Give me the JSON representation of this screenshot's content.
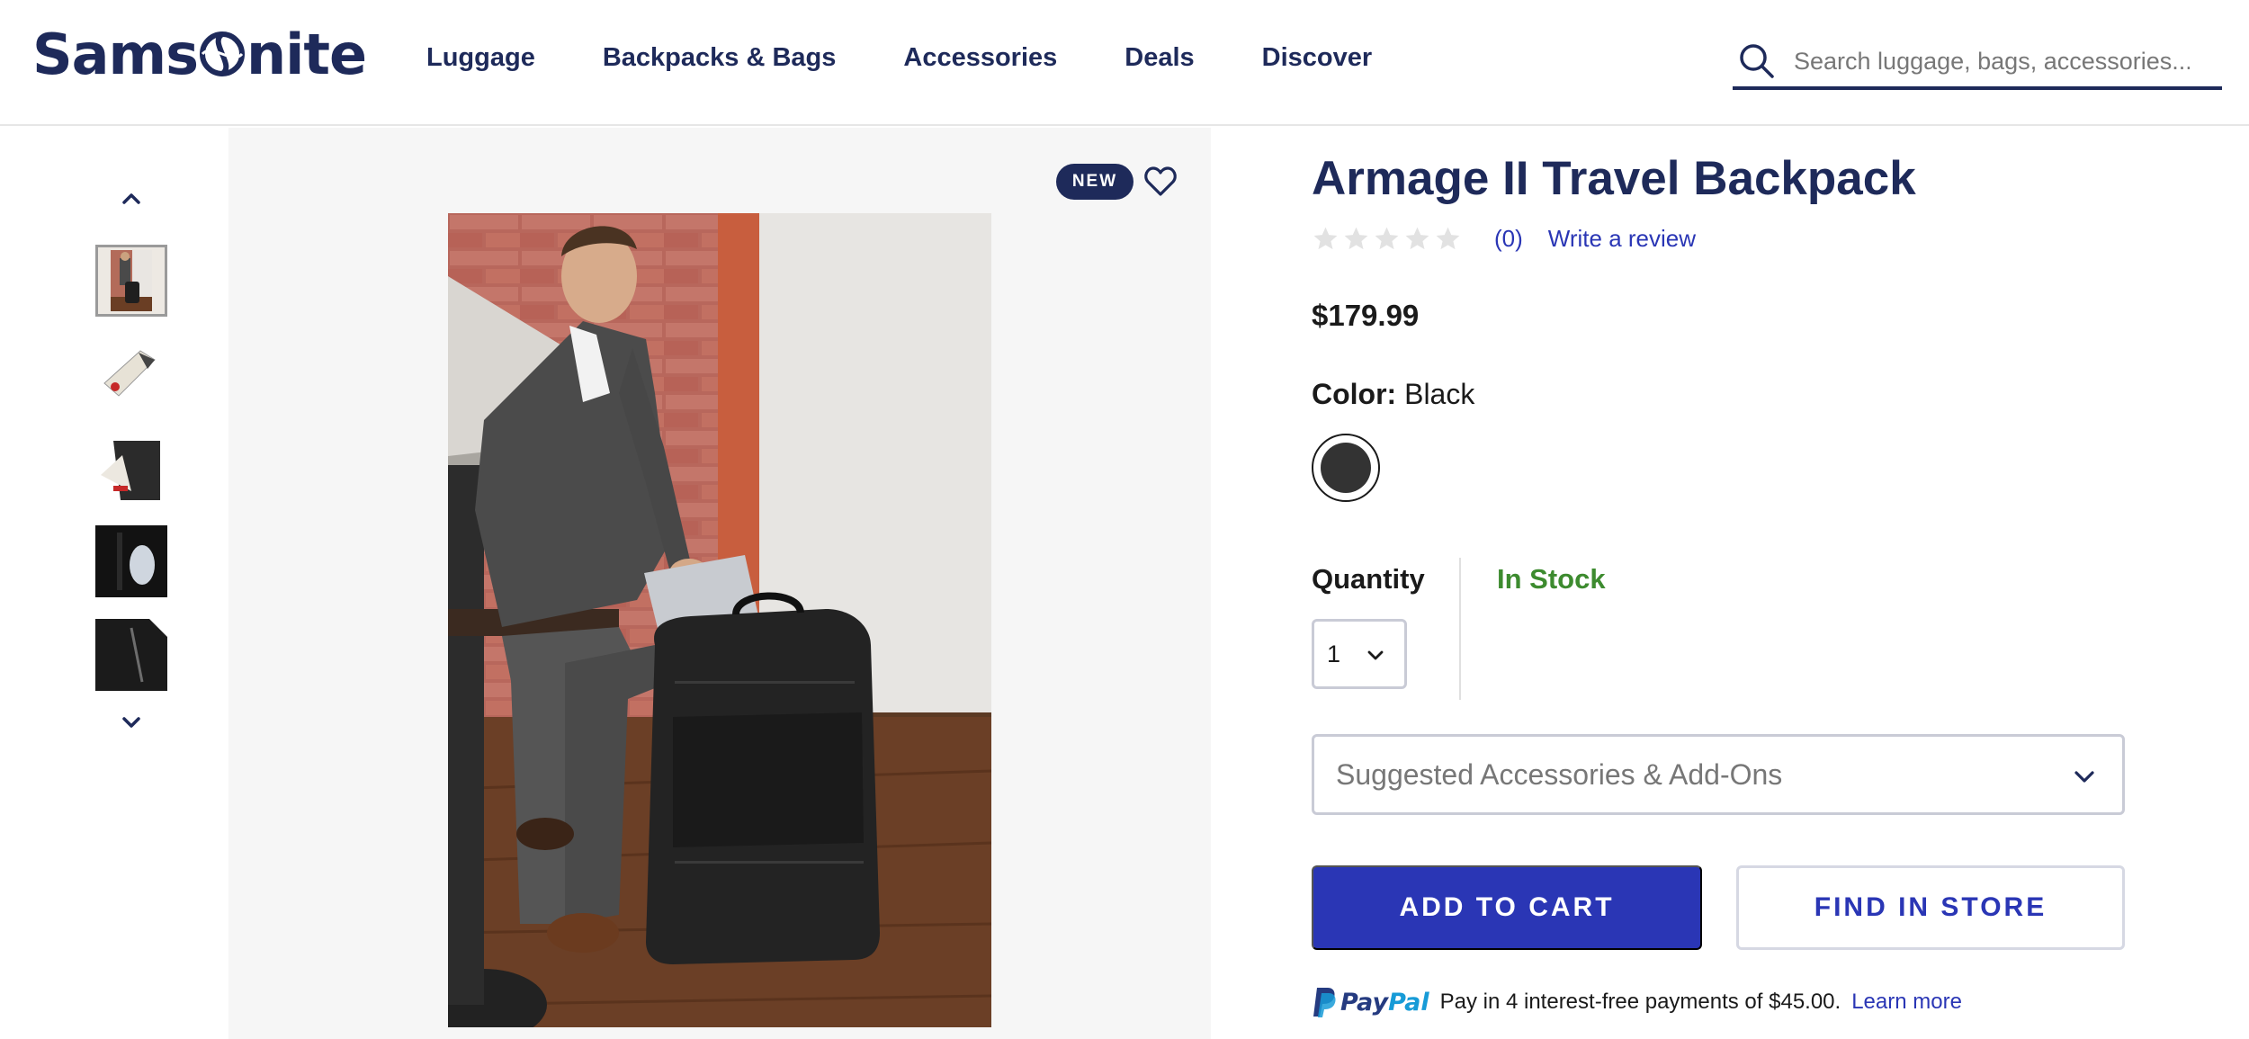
{
  "brand": {
    "logo_text": "Samsonite"
  },
  "nav": {
    "items": [
      "Luggage",
      "Backpacks & Bags",
      "Accessories",
      "Deals",
      "Discover"
    ]
  },
  "search": {
    "placeholder": "Search luggage, bags, accessories..."
  },
  "gallery": {
    "badge": "NEW",
    "thumbnail_count": 5,
    "selected_thumbnail": 1
  },
  "product": {
    "title": "Armage II Travel Backpack",
    "rating": {
      "stars": 0,
      "max_stars": 5,
      "review_count": "(0)",
      "write_review": "Write a review"
    },
    "price": "$179.99",
    "color": {
      "label": "Color:",
      "value": "Black",
      "swatch_hex": "#333333"
    },
    "quantity": {
      "label": "Quantity",
      "value": "1"
    },
    "stock_status": "In Stock",
    "accessories_label": "Suggested Accessories & Add-Ons",
    "add_to_cart": "ADD TO CART",
    "find_in_store": "FIND IN STORE",
    "paypal": {
      "message": "Pay in 4 interest-free payments of $45.00.",
      "learn_more": "Learn more"
    }
  },
  "colors": {
    "brand_navy": "#1e2a5a",
    "primary_button": "#2a36b5",
    "in_stock_green": "#3d8b2f",
    "image_panel_bg": "#f6f6f6"
  }
}
